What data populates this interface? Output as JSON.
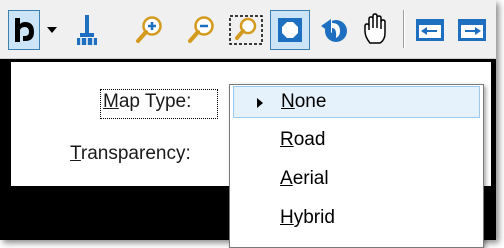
{
  "toolbar": {
    "tools": [
      {
        "icon": "select-arrow-icon"
      },
      {
        "icon": "dropdown-arrow-icon"
      },
      {
        "icon": "paint-brush-icon"
      },
      {
        "icon": "zoom-in-icon"
      },
      {
        "icon": "zoom-out-icon"
      },
      {
        "icon": "zoom-window-icon"
      },
      {
        "icon": "fit-view-icon"
      },
      {
        "icon": "rotate-view-icon"
      },
      {
        "icon": "pan-hand-icon"
      },
      {
        "icon": "previous-view-icon"
      },
      {
        "icon": "next-view-icon"
      }
    ]
  },
  "form": {
    "map_type_label": {
      "mnemonic": "M",
      "rest": "ap Type:"
    },
    "transparency_label": {
      "mnemonic": "T",
      "rest": "ransparency:"
    }
  },
  "dropdown": {
    "selected": "None",
    "options": [
      {
        "mnemonic": "N",
        "rest": "one"
      },
      {
        "mnemonic": "R",
        "rest": "oad"
      },
      {
        "mnemonic": "A",
        "rest": "erial"
      },
      {
        "mnemonic": "H",
        "rest": "ybrid"
      }
    ]
  },
  "colors": {
    "accent": "#1e6fc0",
    "selection_fill": "#e5f1fb",
    "selection_border": "#99c9ef"
  }
}
